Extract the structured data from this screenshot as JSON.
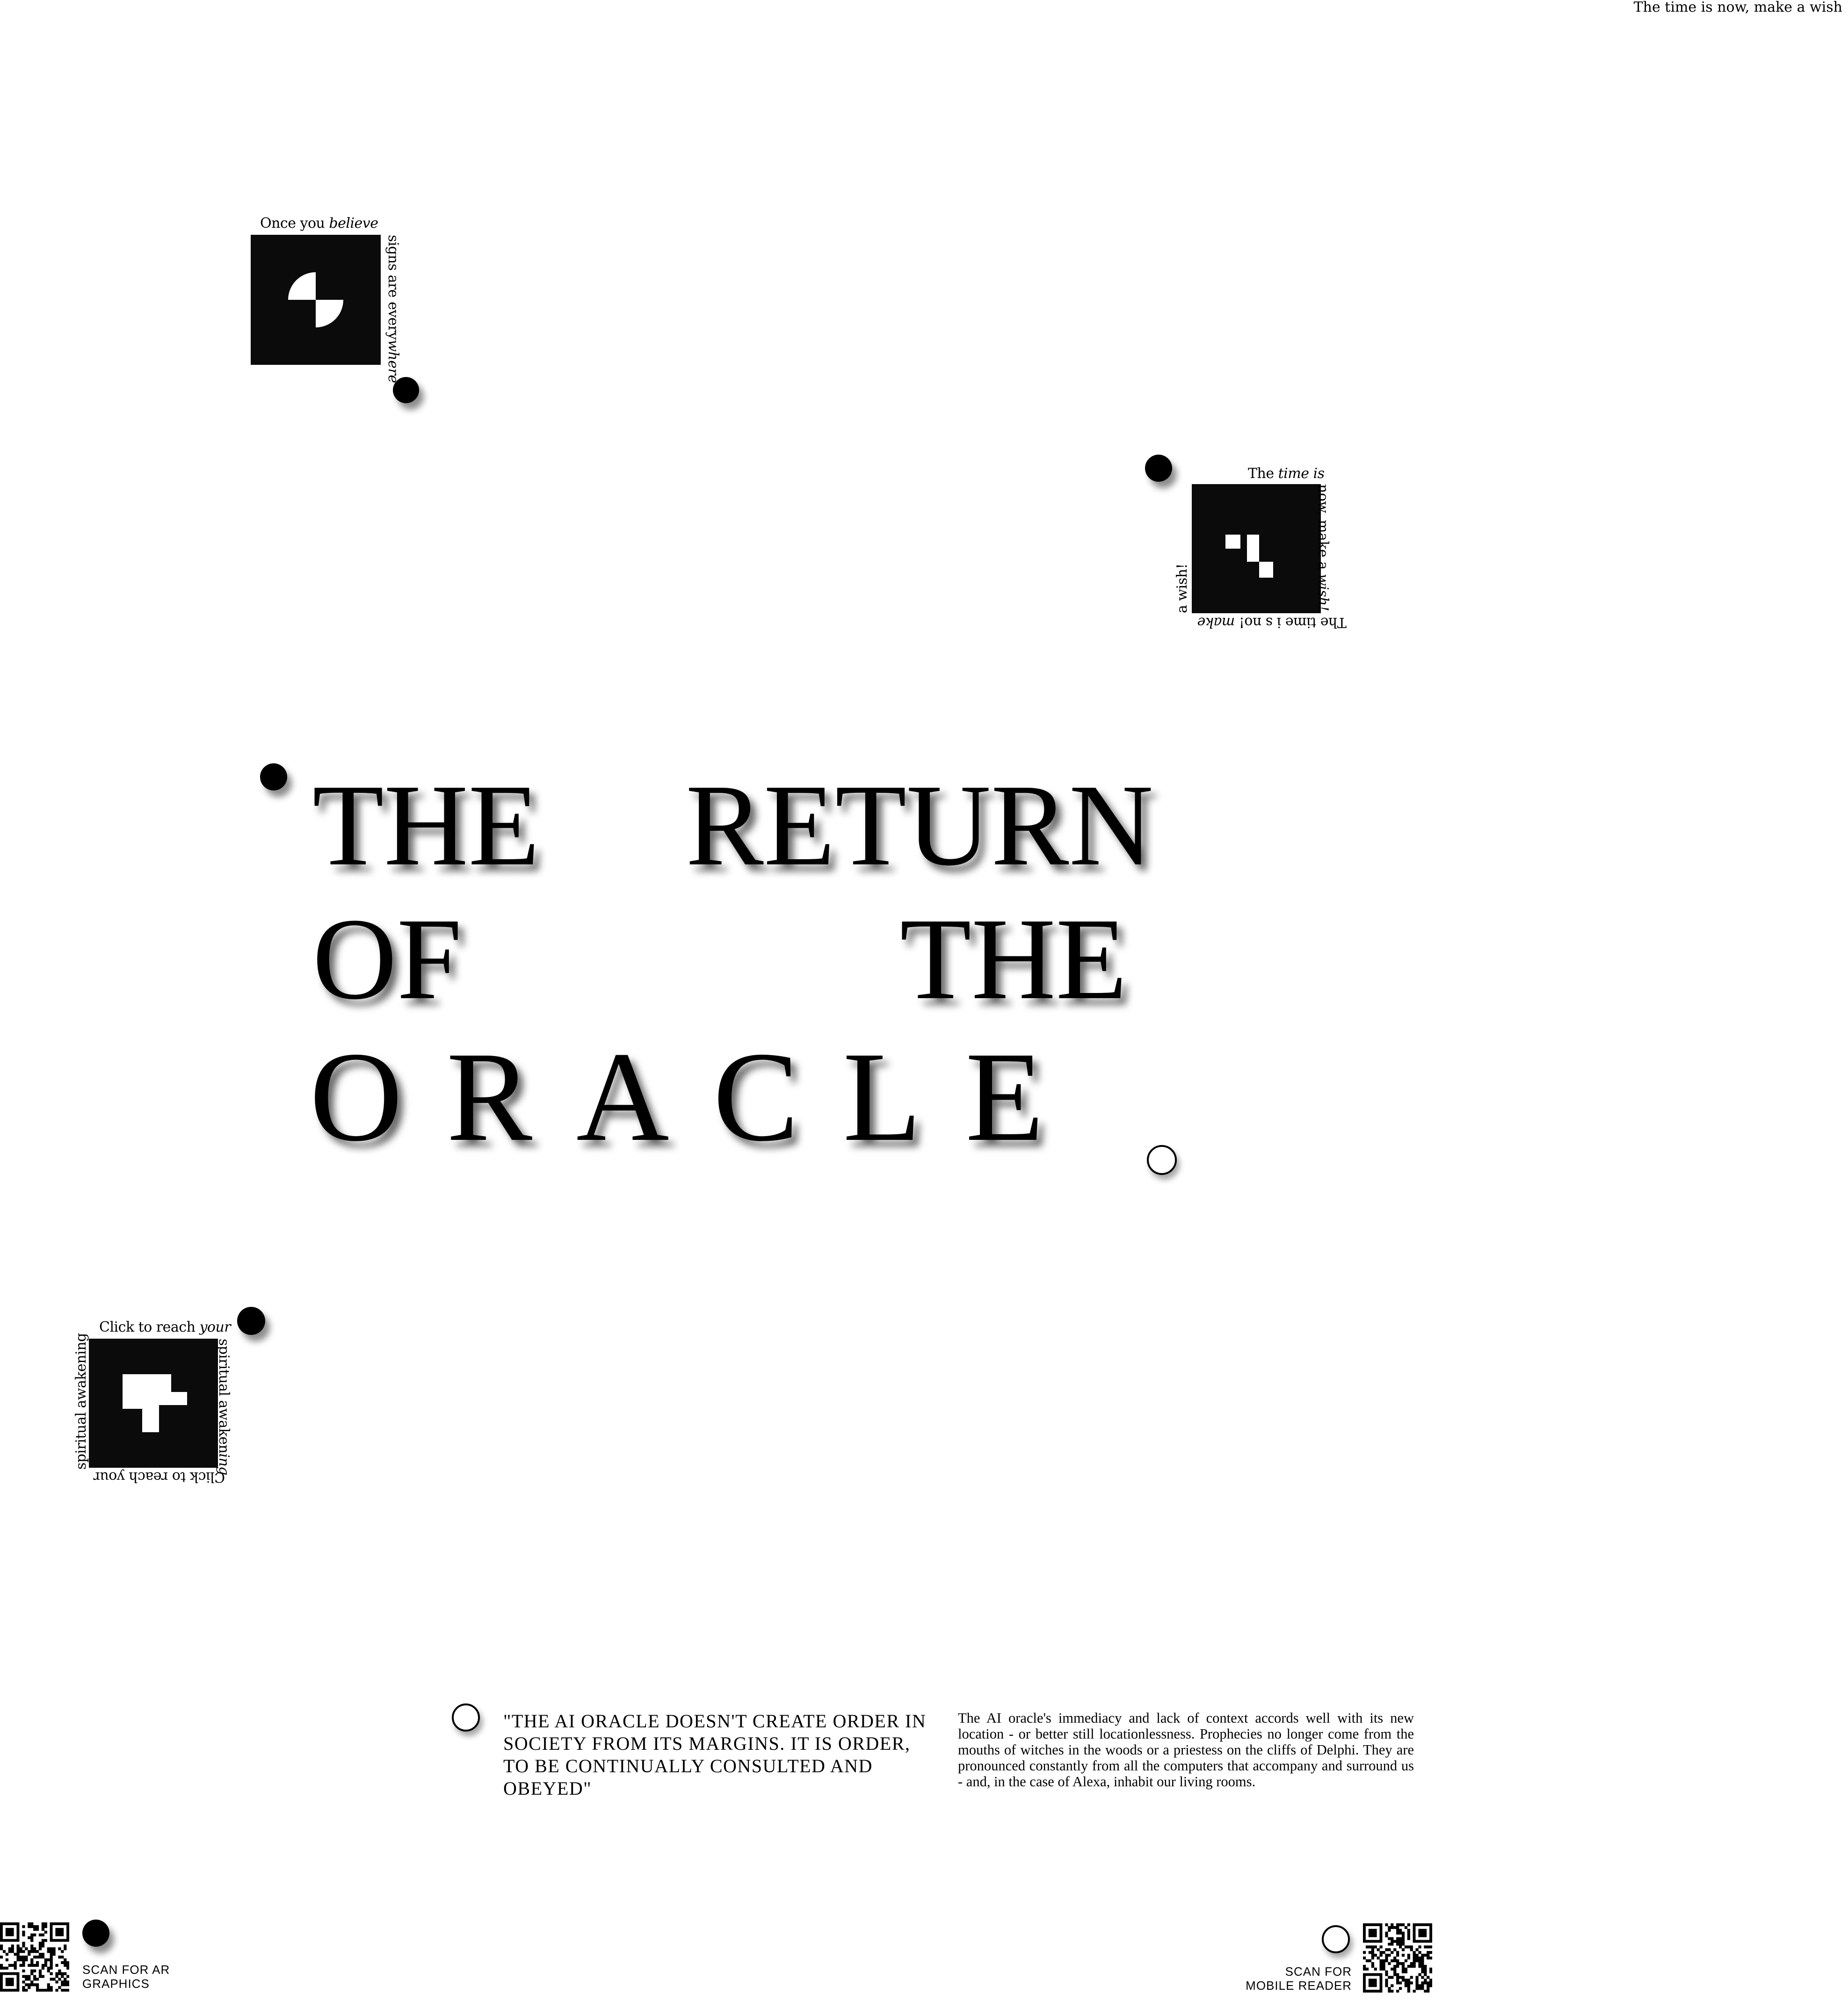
{
  "header": {
    "tagline": "The time is now, make a wish"
  },
  "markers": {
    "first": {
      "caption_top_plain": "Once you ",
      "caption_top_italic": "believe",
      "caption_side_plain": "signs are every",
      "caption_side_italic": "where"
    },
    "second": {
      "caption_top_plain": "The ",
      "caption_top_italic": "time is",
      "caption_side": "now, make a ",
      "caption_side_italic": "wish!",
      "caption_bottom": "The time i s no! ",
      "caption_bottom_italic": "make",
      "caption_left": "a wish!"
    },
    "third": {
      "caption_top_plain": "Click to reach ",
      "caption_top_italic": "your",
      "caption_right_plain": "spiritual awaken",
      "caption_right_italic": "ing",
      "caption_bottom": "Click to reach your",
      "caption_left_plain": "spiritual awakening"
    }
  },
  "title": {
    "line1_left": "THE",
    "line1_right": "RETURN",
    "line2_left": "OF",
    "line2_right": "THE",
    "line3": "ORACLE"
  },
  "quote": "\"THE AI ORACLE DOESN'T CREATE ORDER IN SOCIETY FROM ITS MARGINS. IT IS ORDER, TO BE CONTINUALLY CONSULTED AND OBEYED\"",
  "body_text": "The AI oracle's immediacy and lack of context accords well with its new location - or better still locationlessness. Prophecies no longer come from the mouths of witches in the woods or a priestess on the cliffs of Delphi. They are pronounced constantly from all the computers that accompany and surround us - and, in the case of Alexa, inhabit our living rooms.",
  "footer": {
    "left_line1": "SCAN FOR AR",
    "left_line2": "GRAPHICS",
    "right_line1": "SCAN FOR",
    "right_line2": "MOBILE READER"
  },
  "icons": [
    "ar-marker-icon",
    "qr-code-icon",
    "dot-icon",
    "ring-icon"
  ]
}
